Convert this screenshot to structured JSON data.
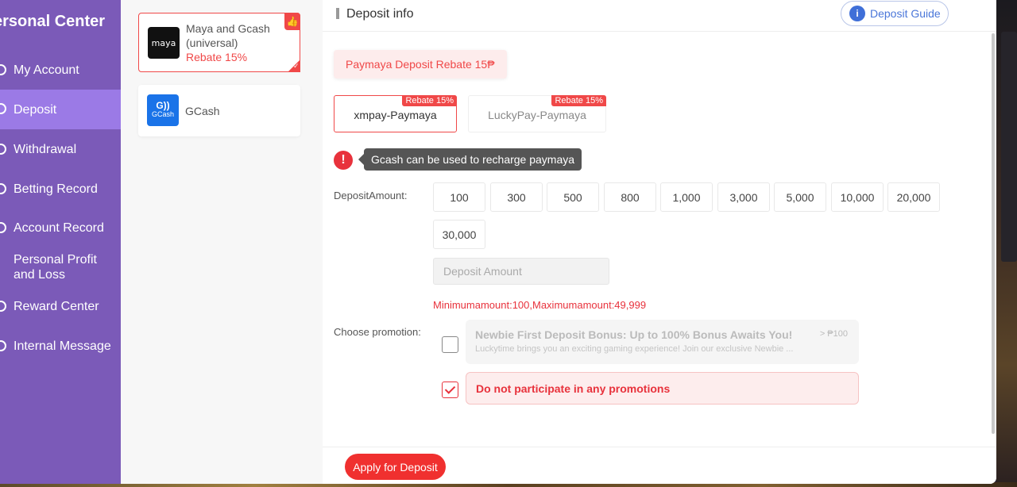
{
  "sidebar": {
    "title": "ersonal Center",
    "items": [
      {
        "label": "My Account",
        "icon": "account-icon",
        "active": false
      },
      {
        "label": "Deposit",
        "icon": "deposit-icon",
        "active": true
      },
      {
        "label": "Withdrawal",
        "icon": "withdrawal-icon",
        "active": false
      },
      {
        "label": "Betting Record",
        "icon": "betting-icon",
        "active": false
      },
      {
        "label": "Account Record",
        "icon": "record-icon",
        "active": false
      },
      {
        "label": "Personal Profit and Loss",
        "icon": "profit-icon",
        "active": false
      },
      {
        "label": "Reward Center",
        "icon": "reward-icon",
        "active": false
      },
      {
        "label": "Internal Message",
        "icon": "message-icon",
        "active": false
      }
    ]
  },
  "channels": [
    {
      "logo_text": "maya",
      "name": "Maya and Gcash (universal)",
      "rebate": "Rebate 15%",
      "selected": true
    },
    {
      "logo_text": "GCash",
      "name": "GCash",
      "rebate": "",
      "selected": false
    }
  ],
  "main": {
    "section_title": "Deposit info",
    "guide_button": "Deposit Guide",
    "rebate_banner": "Paymaya Deposit Rebate 15₱",
    "pay_options": [
      {
        "label": "xmpay-Paymaya",
        "tag": "Rebate 15%",
        "selected": true
      },
      {
        "label": "LuckyPay-Paymaya",
        "tag": "Rebate 15%",
        "selected": false
      }
    ],
    "warning": "Gcash can be used to recharge paymaya",
    "amount_label": "DepositAmount:",
    "amounts": [
      "100",
      "300",
      "500",
      "800",
      "1,000",
      "3,000",
      "5,000",
      "10,000",
      "20,000",
      "30,000"
    ],
    "amount_placeholder": "Deposit Amount",
    "limits": "Minimumamount:100,Maximumamount:49,999",
    "promotion_label": "Choose promotion:",
    "promotions": [
      {
        "title": "Newbie First Deposit Bonus: Up to 100% Bonus Awaits You!",
        "desc": "Luckytime brings you an exciting gaming experience! Join our exclusive Newbie ...",
        "value": "> ₱100",
        "checked": false
      },
      {
        "title": "Do not participate in any promotions",
        "checked": true
      }
    ],
    "apply_button": "Apply for Deposit"
  },
  "colors": {
    "sidebar": "#7b5ab8",
    "sidebar_active": "#9b7ae6",
    "accent_red": "#f0302f",
    "guide_blue": "#4a76d9"
  }
}
